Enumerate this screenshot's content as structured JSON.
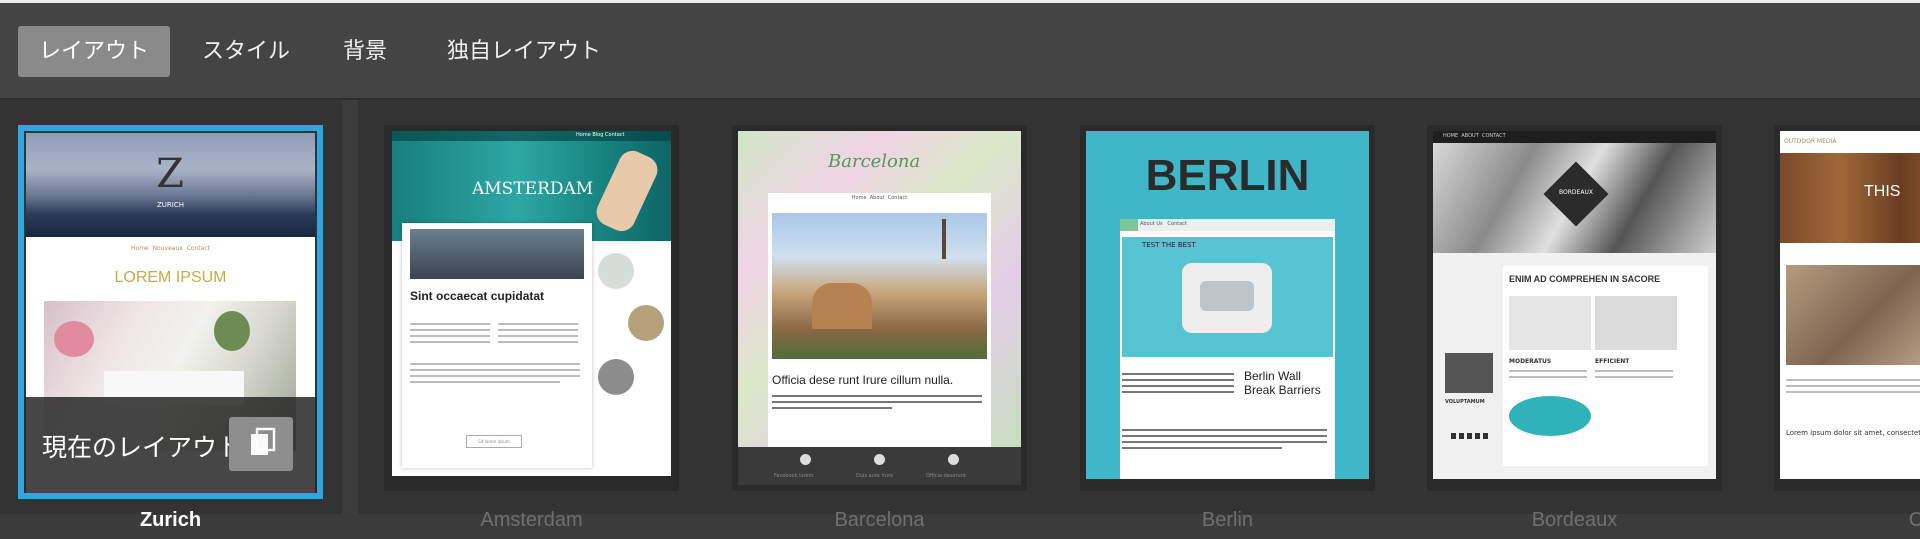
{
  "tabs": [
    {
      "label": "レイアウト",
      "active": true
    },
    {
      "label": "スタイル",
      "active": false
    },
    {
      "label": "背景",
      "active": false
    },
    {
      "label": "独自レイアウト",
      "active": false
    }
  ],
  "current_overlay": {
    "label": "現在のレイアウト",
    "icon": "copy-icon"
  },
  "templates": [
    {
      "name": "Zurich",
      "current": true,
      "preview": {
        "logo": "ZURICH",
        "nav": [
          "Home",
          "Nouveaux",
          "Contact"
        ],
        "heading": "LOREM IPSUM"
      }
    },
    {
      "name": "Amsterdam",
      "current": false,
      "preview": {
        "logo": "AMSTERDAM",
        "nav": [
          "Home",
          "Blog",
          "Contact"
        ],
        "heading": "Sint occaecat cupidatat",
        "button": "Sit lorem ipsum"
      }
    },
    {
      "name": "Barcelona",
      "current": false,
      "preview": {
        "logo": "Barcelona",
        "nav": [
          "Home",
          "About",
          "Contact"
        ],
        "heading": "Officia dese runt Irure cillum nulla.",
        "footer": [
          "Facebook lorem",
          "Duis aute irure",
          "Officia deserunt"
        ]
      }
    },
    {
      "name": "Berlin",
      "current": false,
      "preview": {
        "logo": "BERLIN",
        "nav": [
          "Home",
          "About Us",
          "Contact"
        ],
        "tag": "TEST THE BEST",
        "heading": "Berlin Wall Break Barriers"
      }
    },
    {
      "name": "Bordeaux",
      "current": false,
      "preview": {
        "logo": "BORDEAUX",
        "nav": [
          "HOME",
          "ABOUT",
          "CONTACT"
        ],
        "heading": "ENIM AD COMPREHEN IN SACORE",
        "sub1": "MODERATUS",
        "sub2": "EFFICIENT",
        "side": "VOLUPTAMUM"
      }
    },
    {
      "name": "Ca",
      "current": false,
      "preview": {
        "logo": "OUTDOOR MEDIA",
        "hero": "THIS",
        "heading": "Lorem ipsum dolor sit amet, consectetur"
      }
    }
  ],
  "colors": {
    "accent_selected": "#2ea7e0",
    "active_tab": "#8a8a8a",
    "berlin_teal": "#3fb7c9",
    "amsterdam_teal": "#1f8f8f"
  }
}
